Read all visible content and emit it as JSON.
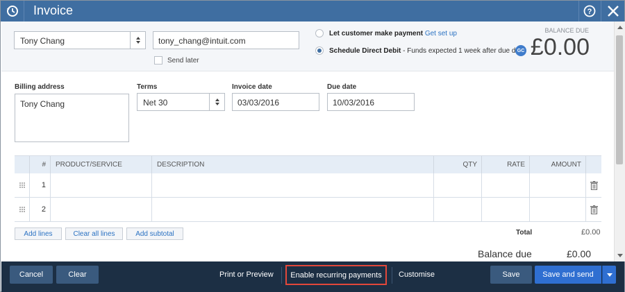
{
  "window": {
    "title": "Invoice",
    "history_icon": "history-icon",
    "help_icon": "help-icon",
    "close_icon": "close-icon"
  },
  "customer": {
    "name": "Tony Chang",
    "email": "tony_chang@intuit.com",
    "send_later_label": "Send later",
    "send_later_checked": false
  },
  "payment_options": {
    "option1": {
      "label": "Let customer make payment",
      "link": "Get set up",
      "selected": false
    },
    "option2": {
      "label": "Schedule Direct Debit",
      "detail": " - Funds expected 1 week after due date",
      "badge": "GC",
      "selected": true
    }
  },
  "balance": {
    "label": "BALANCE DUE",
    "amount": "£0.00"
  },
  "billing": {
    "label": "Billing address",
    "value": "Tony Chang"
  },
  "terms": {
    "label": "Terms",
    "value": "Net 30"
  },
  "invoice_date": {
    "label": "Invoice date",
    "value": "03/03/2016"
  },
  "due_date": {
    "label": "Due date",
    "value": "10/03/2016"
  },
  "table": {
    "columns": [
      "#",
      "PRODUCT/SERVICE",
      "DESCRIPTION",
      "QTY",
      "RATE",
      "AMOUNT"
    ],
    "rows": [
      {
        "num": "1",
        "product": "",
        "description": "",
        "qty": "",
        "rate": "",
        "amount": ""
      },
      {
        "num": "2",
        "product": "",
        "description": "",
        "qty": "",
        "rate": "",
        "amount": ""
      }
    ]
  },
  "line_actions": {
    "add_lines": "Add lines",
    "clear_all_lines": "Clear all lines",
    "add_subtotal": "Add subtotal"
  },
  "totals": {
    "total_label": "Total",
    "total_value": "£0.00",
    "balance_due_label": "Balance due",
    "balance_due_value": "£0.00"
  },
  "footer": {
    "cancel": "Cancel",
    "clear": "Clear",
    "print_preview": "Print or Preview",
    "enable_recurring": "Enable recurring payments",
    "customise": "Customise",
    "save": "Save",
    "save_and_send": "Save and send"
  },
  "colors": {
    "titlebar": "#3f6ea1",
    "footer": "#1c2f44",
    "primary_button": "#2f6fd1",
    "highlight_border": "#e2473a",
    "link": "#2b72c2"
  }
}
